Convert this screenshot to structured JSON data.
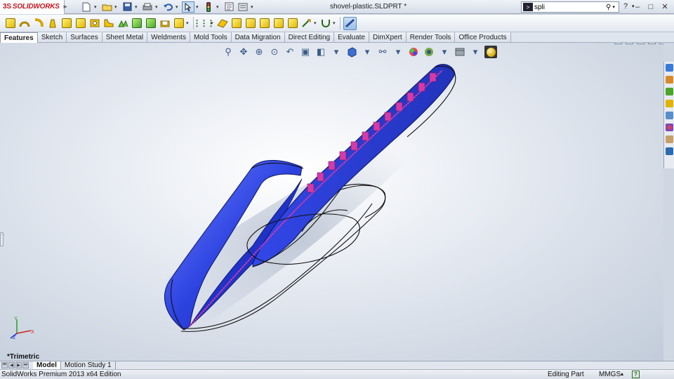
{
  "app": {
    "logo_text": "SOLIDWORKS",
    "logo_prefix": "3S",
    "document_title": "shovel-plastic.SLDPRT *"
  },
  "search": {
    "value": "spli",
    "placeholder": ""
  },
  "command_manager": {
    "tabs": [
      {
        "label": "Features",
        "active": true
      },
      {
        "label": "Sketch"
      },
      {
        "label": "Surfaces"
      },
      {
        "label": "Sheet Metal"
      },
      {
        "label": "Weldments"
      },
      {
        "label": "Mold Tools"
      },
      {
        "label": "Data Migration"
      },
      {
        "label": "Direct Editing"
      },
      {
        "label": "Evaluate"
      },
      {
        "label": "DimXpert"
      },
      {
        "label": "Render Tools"
      },
      {
        "label": "Office Products"
      }
    ]
  },
  "viewport": {
    "view_name": "*Trimetric",
    "triad": {
      "x": "X",
      "y": "Y",
      "z": "Z"
    }
  },
  "bottom_tabs": [
    {
      "label": "Model",
      "active": true
    },
    {
      "label": "Motion Study 1"
    }
  ],
  "status": {
    "product": "SolidWorks Premium 2013 x64 Edition",
    "mode": "Editing Part",
    "units": "MMGS",
    "help": "?"
  },
  "colors": {
    "part_blue": "#2b3fd6",
    "rib_magenta": "#d43aa8",
    "brand_red": "#c0161d"
  },
  "icons": {
    "help": "?",
    "minimize": "–",
    "restore": "□",
    "close": "✕"
  }
}
